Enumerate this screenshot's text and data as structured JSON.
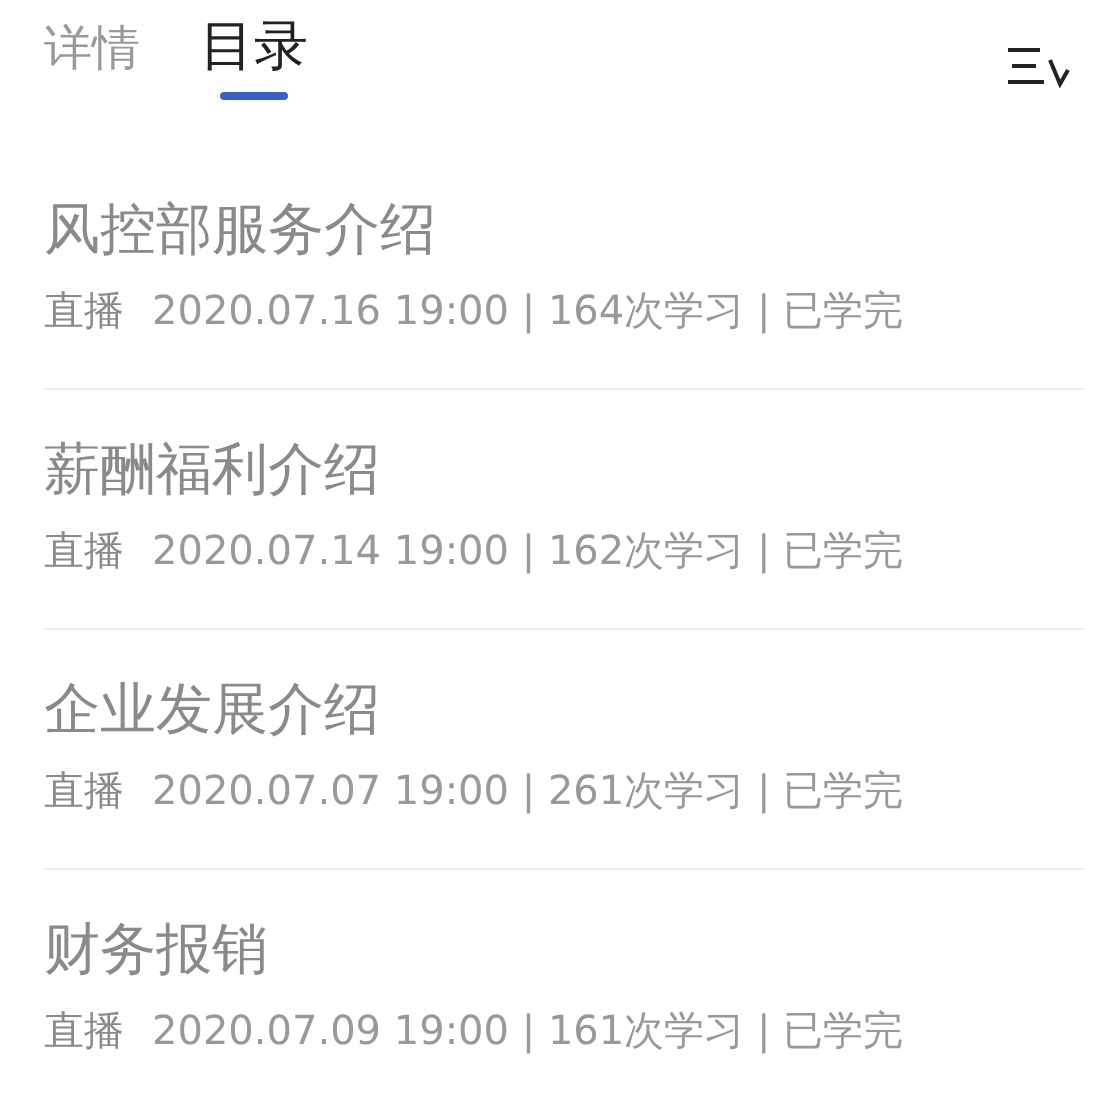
{
  "tabs": [
    {
      "label": "详情",
      "selected": false
    },
    {
      "label": "目录",
      "selected": true
    }
  ],
  "items": [
    {
      "title": "风控部服务介绍",
      "tag": "直播",
      "info": "2020.07.16 19:00 | 164次学习 | 已学完"
    },
    {
      "title": "薪酬福利介绍",
      "tag": "直播",
      "info": "2020.07.14 19:00 | 162次学习 | 已学完"
    },
    {
      "title": "企业发展介绍",
      "tag": "直播",
      "info": "2020.07.07 19:00 | 261次学习 | 已学完"
    },
    {
      "title": "财务报销",
      "tag": "直播",
      "info": "2020.07.09 19:00 | 161次学习 | 已学完"
    }
  ]
}
